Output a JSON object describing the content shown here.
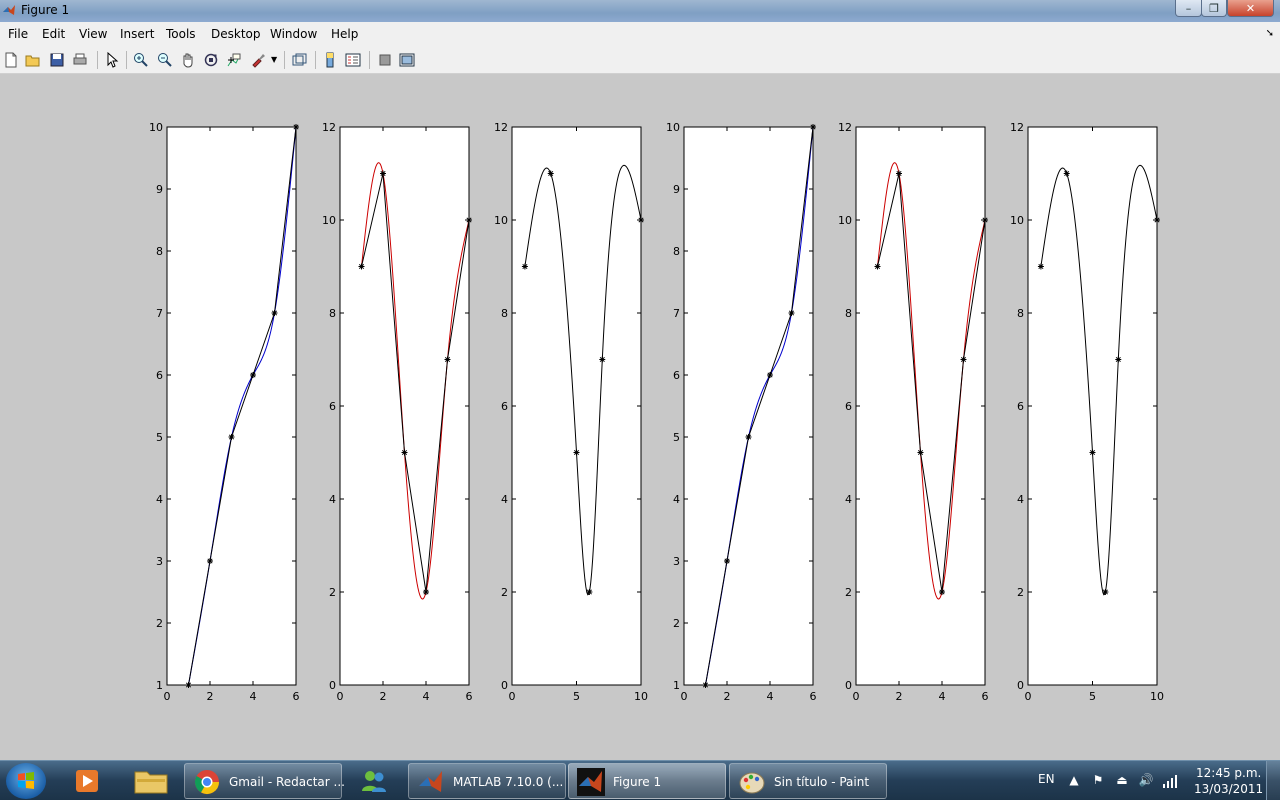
{
  "window": {
    "title": "Figure 1",
    "controls": {
      "minimize": "–",
      "maximize": "❐",
      "close": "✕"
    }
  },
  "menu": [
    "File",
    "Edit",
    "View",
    "Insert",
    "Tools",
    "Desktop",
    "Window",
    "Help"
  ],
  "toolbar": {
    "buttons": [
      "new-figure-icon",
      "open-icon",
      "save-icon",
      "print-icon",
      "arrow-select-icon",
      "zoom-in-icon",
      "zoom-out-icon",
      "pan-hand-icon",
      "rotate-3d-icon",
      "data-cursor-icon",
      "brush-icon",
      "link-plot-icon",
      "colorbar-icon",
      "legend-icon",
      "hide-plot-tools-icon",
      "show-plot-tools-icon"
    ]
  },
  "colors": {
    "interp_blue": "#0000cc",
    "interp_red": "#cc0000",
    "data_black": "#000000"
  },
  "chart_data": [
    {
      "type": "line",
      "xlim": [
        0,
        6
      ],
      "ylim": [
        1,
        10
      ],
      "xticks": [
        "0",
        "2",
        "4",
        "6"
      ],
      "yticks": [
        "1",
        "2",
        "3",
        "4",
        "5",
        "6",
        "7",
        "8",
        "9",
        "10"
      ],
      "points": {
        "x": [
          1,
          2,
          3,
          4,
          5,
          6
        ],
        "y": [
          1,
          3,
          5,
          6,
          7,
          10
        ]
      },
      "series": [
        {
          "color": "blue",
          "kind": "spline"
        },
        {
          "color": "black",
          "kind": "piecewise-linear"
        }
      ]
    },
    {
      "type": "line",
      "xlim": [
        0,
        6
      ],
      "ylim": [
        0,
        12
      ],
      "xticks": [
        "0",
        "2",
        "4",
        "6"
      ],
      "yticks": [
        "0",
        "2",
        "4",
        "6",
        "8",
        "10",
        "12"
      ],
      "points": {
        "x": [
          1,
          2,
          3,
          4,
          5,
          6
        ],
        "y": [
          9,
          11,
          5,
          2,
          7,
          10
        ]
      },
      "series": [
        {
          "color": "red",
          "kind": "spline"
        },
        {
          "color": "black",
          "kind": "piecewise-linear"
        }
      ]
    },
    {
      "type": "line",
      "xlim": [
        0,
        10
      ],
      "ylim": [
        0,
        12
      ],
      "xticks": [
        "0",
        "5",
        "10"
      ],
      "yticks": [
        "0",
        "2",
        "4",
        "6",
        "8",
        "10",
        "12"
      ],
      "points": {
        "x": [
          1,
          3,
          5,
          6,
          7,
          10
        ],
        "y": [
          9,
          11,
          5,
          2,
          7,
          10
        ]
      },
      "series": [
        {
          "color": "black",
          "kind": "spline"
        }
      ]
    },
    {
      "type": "line",
      "xlim": [
        0,
        6
      ],
      "ylim": [
        1,
        10
      ],
      "xticks": [
        "0",
        "2",
        "4",
        "6"
      ],
      "yticks": [
        "1",
        "2",
        "3",
        "4",
        "5",
        "6",
        "7",
        "8",
        "9",
        "10"
      ],
      "points": {
        "x": [
          1,
          2,
          3,
          4,
          5,
          6
        ],
        "y": [
          1,
          3,
          5,
          6,
          7,
          10
        ]
      },
      "series": [
        {
          "color": "blue",
          "kind": "spline"
        },
        {
          "color": "black",
          "kind": "piecewise-linear"
        }
      ]
    },
    {
      "type": "line",
      "xlim": [
        0,
        6
      ],
      "ylim": [
        0,
        12
      ],
      "xticks": [
        "0",
        "2",
        "4",
        "6"
      ],
      "yticks": [
        "0",
        "2",
        "4",
        "6",
        "8",
        "10",
        "12"
      ],
      "points": {
        "x": [
          1,
          2,
          3,
          4,
          5,
          6
        ],
        "y": [
          9,
          11,
          5,
          2,
          7,
          10
        ]
      },
      "series": [
        {
          "color": "red",
          "kind": "spline"
        },
        {
          "color": "black",
          "kind": "piecewise-linear"
        }
      ]
    },
    {
      "type": "line",
      "xlim": [
        0,
        10
      ],
      "ylim": [
        0,
        12
      ],
      "xticks": [
        "0",
        "5",
        "10"
      ],
      "yticks": [
        "0",
        "2",
        "4",
        "6",
        "8",
        "10",
        "12"
      ],
      "points": {
        "x": [
          1,
          3,
          5,
          6,
          7,
          10
        ],
        "y": [
          9,
          11,
          5,
          2,
          7,
          10
        ]
      },
      "series": [
        {
          "color": "black",
          "kind": "spline"
        }
      ]
    }
  ],
  "taskbar": {
    "pinned": [
      "media-player-icon",
      "explorer-folder-icon"
    ],
    "tasks": [
      {
        "label": "Gmail - Redactar ...",
        "icon": "chrome-icon",
        "active": false
      },
      {
        "label": "MATLAB  7.10.0 (...",
        "icon": "matlab-icon",
        "active": false
      },
      {
        "label": "Figure 1",
        "icon": "matlab-icon",
        "active": true
      },
      {
        "label": "Sin título - Paint",
        "icon": "paint-icon",
        "active": false
      }
    ],
    "tray": {
      "language": "EN",
      "time": "12:45 p.m.",
      "date": "13/03/2011"
    }
  }
}
